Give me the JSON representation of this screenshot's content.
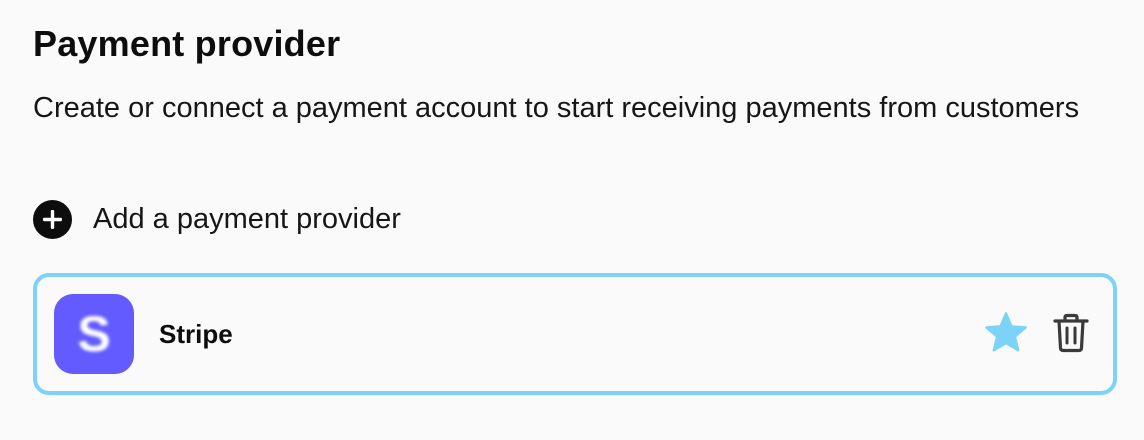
{
  "section": {
    "title": "Payment provider",
    "description": "Create or connect a payment account to start receiving payments from customers"
  },
  "add_provider": {
    "label": "Add a payment provider",
    "icon": "plus-circle-icon"
  },
  "providers": [
    {
      "name": "Stripe",
      "logo_letter": "S",
      "logo_color": "#635bff",
      "is_default": true,
      "actions": {
        "favorite_icon": "star-icon",
        "delete_icon": "trash-icon"
      }
    }
  ],
  "colors": {
    "selected_border": "#7dd3f7",
    "star_active": "#7dd3f7",
    "text": "#111111",
    "background": "#fafafa"
  }
}
